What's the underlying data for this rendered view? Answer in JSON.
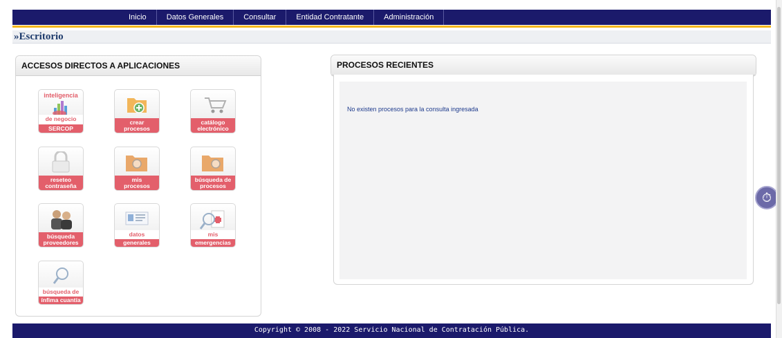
{
  "nav": {
    "items": [
      "Inicio",
      "Datos Generales",
      "Consultar",
      "Entidad Contratante",
      "Administración"
    ]
  },
  "breadcrumb": "»Escritorio",
  "left_panel": {
    "title": "ACCESOS DIRECTOS A APLICACIONES",
    "apps": [
      {
        "top": "inteligencia",
        "l1": "de negocio",
        "l2": "SERCOP",
        "icon": "bar-chart-icon"
      },
      {
        "l1": "crear",
        "l2": "procesos",
        "icon": "add-folder-icon"
      },
      {
        "l1": "catálogo",
        "l2": "electrónico",
        "icon": "shopping-cart-icon"
      },
      {
        "l1": "reseteo",
        "l2": "contraseña",
        "icon": "padlock-icon"
      },
      {
        "l1": "mis",
        "l2": "procesos",
        "icon": "folder-search-icon"
      },
      {
        "l1": "búsqueda de",
        "l2": "procesos",
        "icon": "folder-search-icon"
      },
      {
        "l1": "búsqueda",
        "l2": "proveedores",
        "icon": "people-icon"
      },
      {
        "l1": "datos",
        "l2": "generales",
        "icon": "id-card-icon"
      },
      {
        "l1": "mis",
        "l2": "emergencias",
        "icon": "medical-search-icon"
      },
      {
        "l1": "búsqueda de",
        "l2": "ínfima cuantía",
        "icon": "magnifier-icon"
      }
    ]
  },
  "right_panel": {
    "title": "PROCESOS RECIENTES",
    "message": "No existen procesos para la consulta ingresada"
  },
  "footer": "Copyright © 2008 - 2022 Servicio Nacional de Contratación Pública.",
  "colors": {
    "nav_bg": "#1b1a6b",
    "accent": "#f5b81a",
    "app_label": "#e35f6b"
  }
}
